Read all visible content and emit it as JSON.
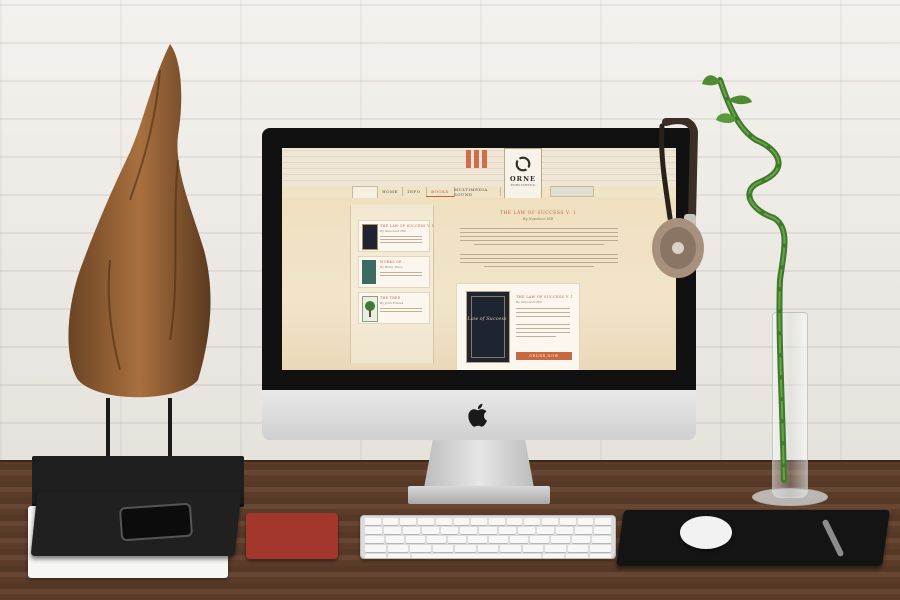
{
  "scene": {
    "colors": {
      "wall": "#eeeae4",
      "desk": "#5b3c28",
      "accent": "#c3623f"
    }
  },
  "website": {
    "logo": {
      "name": "ORNE",
      "subtitle": "PUBLISHING"
    },
    "nav": {
      "home": "HOME",
      "info": "INFO",
      "books": "BOOKS",
      "multimedia": "MULTIMEDIA SOUND"
    },
    "sidebar": {
      "cards": [
        {
          "title": "THE LAW OF SUCCESS V. 1",
          "author": "By Napoleon Hill"
        },
        {
          "title": "WORKS OF...",
          "author": "By Brian Tracy"
        },
        {
          "title": "THE TREE",
          "author": "By John Fowles"
        }
      ]
    },
    "feature": {
      "title": "THE LAW OF SUCCESS V. 1",
      "author": "By Napoleon Hill",
      "book_cover_text": "Law of Success",
      "order_button": "ORDER NOW"
    }
  }
}
